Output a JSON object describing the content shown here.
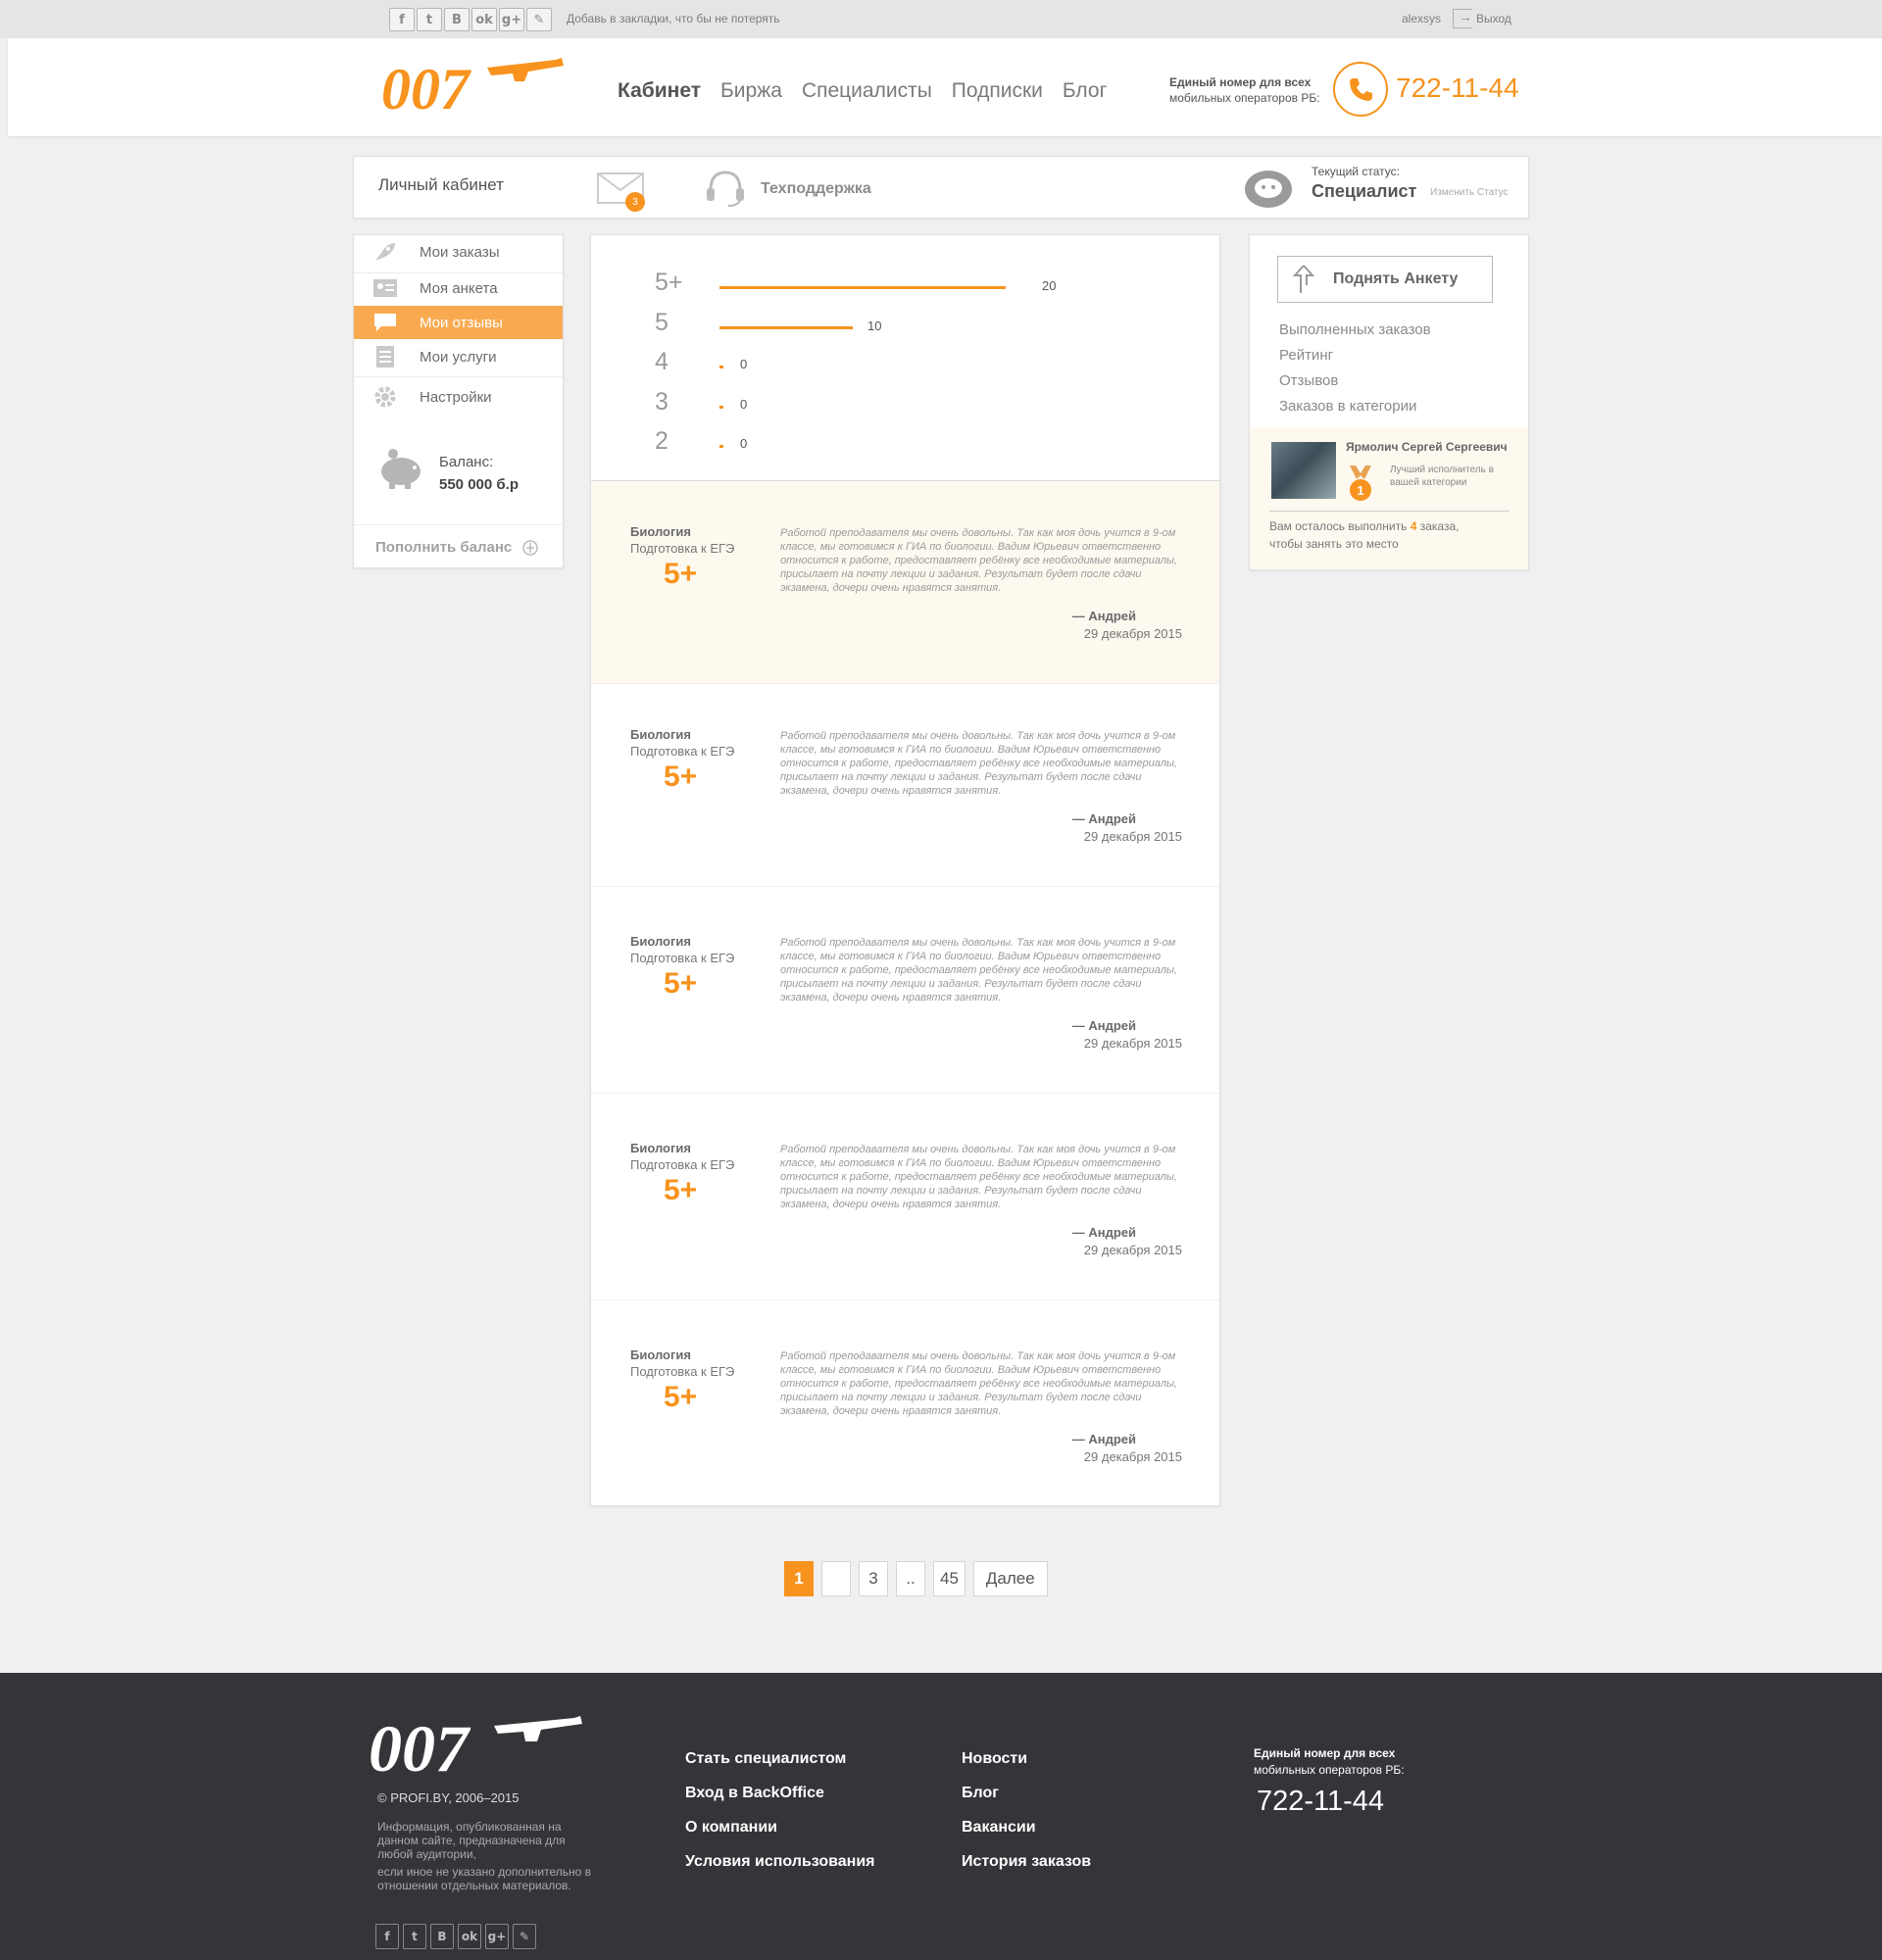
{
  "topbar": {
    "social": [
      "f",
      "t",
      "B",
      "ok",
      "g+",
      "✎"
    ],
    "bookmark_hint": "Добавь в закладки, что бы не потерять",
    "username": "alexsys",
    "logout": "Выход"
  },
  "header": {
    "logo": "007",
    "nav": [
      "Кабинет",
      "Биржа",
      "Специалисты",
      "Подписки",
      "Блог"
    ],
    "phone_label_line1": "Единый номер для всех",
    "phone_label_line2": "мобильных операторов РБ:",
    "phone": "722-11-44"
  },
  "cabinet_bar": {
    "title": "Личный кабинет",
    "mail_count": "3",
    "support": "Техподдержка",
    "status_caption": "Текущий статус:",
    "status_value": "Специалист",
    "status_change": "Изменить Статус"
  },
  "sidebar": {
    "items": [
      {
        "label": "Мои заказы",
        "icon": "rocket-icon"
      },
      {
        "label": "Моя анкета",
        "icon": "id-card-icon"
      },
      {
        "label": "Мои отзывы",
        "icon": "chat-bubble-icon"
      },
      {
        "label": "Мои услуги",
        "icon": "list-icon"
      },
      {
        "label": "Настройки",
        "icon": "gear-icon"
      }
    ],
    "active_index": 2,
    "balance_caption": "Баланс:",
    "balance_value": "550 000 б.р",
    "topup": "Пополнить баланс"
  },
  "ratings": [
    {
      "label": "5+",
      "count": "20"
    },
    {
      "label": "5",
      "count": "10"
    },
    {
      "label": "4",
      "count": "0"
    },
    {
      "label": "3",
      "count": "0"
    },
    {
      "label": "2",
      "count": "0"
    }
  ],
  "reviews": [
    {
      "subject": "Биология",
      "subtitle": "Подготовка к ЕГЭ",
      "grade": "5+",
      "text": "Работой преподавателя мы очень довольны. Так как моя дочь учится в 9-ом классе, мы готовимся к ГИА по биологии. Вадим Юрьевич ответственно относится к работе, предоставляет ребёнку все необходимые материалы, присылает на почту лекции и задания. Результат будет после сдачи экзамена, дочери очень нравятся занятия.",
      "author": "— Андрей",
      "date": "29 декабря 2015"
    },
    {
      "subject": "Биология",
      "subtitle": "Подготовка к ЕГЭ",
      "grade": "5+",
      "text": "Работой преподавателя мы очень довольны. Так как моя дочь учится в 9-ом классе, мы готовимся к ГИА по биологии. Вадим Юрьевич ответственно относится к работе, предоставляет ребёнку все необходимые материалы, присылает на почту лекции и задания. Результат будет после сдачи экзамена, дочери очень нравятся занятия.",
      "author": "— Андрей",
      "date": "29 декабря 2015"
    },
    {
      "subject": "Биология",
      "subtitle": "Подготовка к ЕГЭ",
      "grade": "5+",
      "text": "Работой преподавателя мы очень довольны. Так как моя дочь учится в 9-ом классе, мы готовимся к ГИА по биологии. Вадим Юрьевич ответственно относится к работе, предоставляет ребёнку все необходимые материалы, присылает на почту лекции и задания. Результат будет после сдачи экзамена, дочери очень нравятся занятия.",
      "author": "— Андрей",
      "date": "29 декабря 2015"
    },
    {
      "subject": "Биология",
      "subtitle": "Подготовка к ЕГЭ",
      "grade": "5+",
      "text": "Работой преподавателя мы очень довольны. Так как моя дочь учится в 9-ом классе, мы готовимся к ГИА по биологии. Вадим Юрьевич ответственно относится к работе, предоставляет ребёнку все необходимые материалы, присылает на почту лекции и задания. Результат будет после сдачи экзамена, дочери очень нравятся занятия.",
      "author": "— Андрей",
      "date": "29 декабря 2015"
    },
    {
      "subject": "Биология",
      "subtitle": "Подготовка к ЕГЭ",
      "grade": "5+",
      "text": "Работой преподавателя мы очень довольны. Так как моя дочь учится в 9-ом классе, мы готовимся к ГИА по биологии. Вадим Юрьевич ответственно относится к работе, предоставляет ребёнку все необходимые материалы, присылает на почту лекции и задания. Результат будет после сдачи экзамена, дочери очень нравятся занятия.",
      "author": "— Андрей",
      "date": "29 декабря 2015"
    }
  ],
  "right_panel": {
    "raise_button": "Поднять Анкету",
    "stats": [
      "Выполненных заказов",
      "Рейтинг",
      "Отзывов",
      "Заказов в категории"
    ],
    "best_name": "Ярмолич Сергей Сергеевич",
    "best_desc": "Лучший исполнитель в вашей категории",
    "medal_rank": "1",
    "remaining_before": "Вам осталось выполнить",
    "remaining_count": "4",
    "remaining_after": "заказа,",
    "remaining_line2": "чтобы занять это место"
  },
  "pagination": {
    "pages": [
      "1",
      "",
      "3",
      "..",
      "45"
    ],
    "current": "1",
    "next": "Далее"
  },
  "footer": {
    "logo": "007",
    "copyright": "© PROFI.BY, 2006–2015",
    "info_line1": "Информация, опубликованная на данном сайте, предназначена для любой аудитории,",
    "info_line2": "если иное не указано дополнительно в отношении отдельных материалов.",
    "col1": [
      "Стать специалистом",
      "Вход в BackOffice",
      "О компании",
      "Условия использования"
    ],
    "col2": [
      "Новости",
      "Блог",
      "Вакансии",
      "История заказов"
    ],
    "phone_label_line1": "Единый номер для всех",
    "phone_label_line2": "мобильных операторов РБ:",
    "phone": "722-11-44",
    "social": [
      "f",
      "t",
      "B",
      "ok",
      "g+",
      "✎"
    ]
  },
  "colors": {
    "accent": "#f7931e",
    "sidebar_active": "#f9aa51",
    "footer_bg": "#333539"
  }
}
